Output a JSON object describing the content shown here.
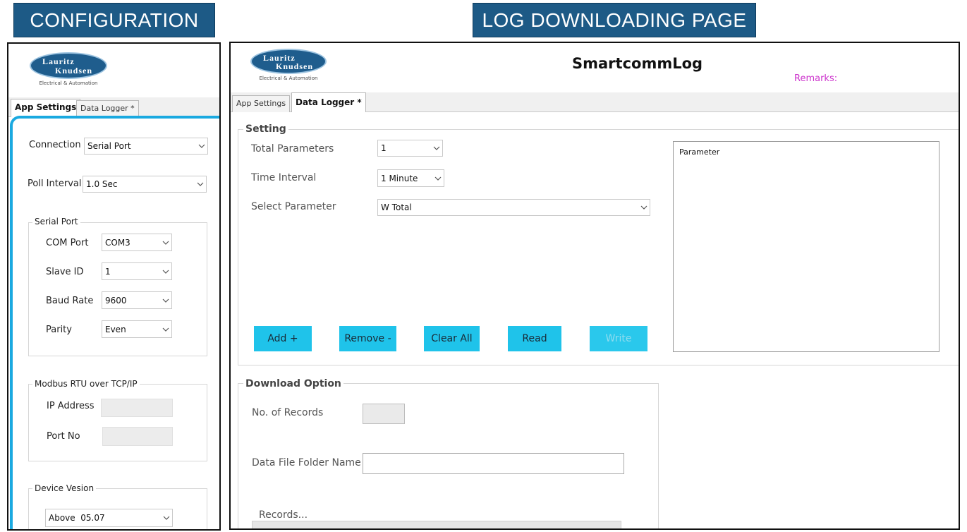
{
  "banners": {
    "left": "CONFIGURATION",
    "right": "LOG DOWNLOADING PAGE"
  },
  "logo": {
    "line1": "Lauritz",
    "line2": "Knudsen",
    "tagline": "Electrical & Automation"
  },
  "config": {
    "tabs": [
      {
        "label": "App Settings",
        "active": true
      },
      {
        "label": "Data Logger *",
        "active": false
      }
    ],
    "connection": {
      "label": "Connection",
      "value": "Serial Port"
    },
    "poll_interval": {
      "label": "Poll Interval",
      "value": "1.0 Sec"
    },
    "serial_port": {
      "title": "Serial Port",
      "com_port": {
        "label": "COM Port",
        "value": "COM3"
      },
      "slave_id": {
        "label": "Slave ID",
        "value": "1"
      },
      "baud_rate": {
        "label": "Baud Rate",
        "value": "9600"
      },
      "parity": {
        "label": "Parity",
        "value": "Even"
      }
    },
    "modbus": {
      "title": "Modbus RTU over TCP/IP",
      "ip_address": {
        "label": "IP Address",
        "value": ""
      },
      "port_no": {
        "label": "Port No",
        "value": ""
      }
    },
    "device_version": {
      "title": "Device Vesion",
      "value": "Above  05.07"
    }
  },
  "logpage": {
    "app_title": "SmartcommLog",
    "remarks_label": "Remarks:",
    "tabs": [
      {
        "label": "App Settings",
        "active": false
      },
      {
        "label": "Data Logger *",
        "active": true
      }
    ],
    "setting": {
      "title": "Setting",
      "total_parameters": {
        "label": "Total Parameters",
        "value": "1"
      },
      "time_interval": {
        "label": "Time Interval",
        "value": "1 Minute"
      },
      "select_parameter": {
        "label": "Select Parameter",
        "value": "W Total"
      },
      "parameter_list_header": "Parameter",
      "buttons": {
        "add": "Add +",
        "remove": "Remove -",
        "clear_all": "Clear All",
        "read": "Read",
        "write": "Write"
      }
    },
    "download": {
      "title": "Download Option",
      "no_of_records": {
        "label": "No. of Records",
        "value": ""
      },
      "folder_name": {
        "label": "Data File Folder Name",
        "value": ""
      },
      "records_label": "Records..."
    }
  },
  "colors": {
    "banner_bg": "#1d5a86",
    "button_bg": "#1fc3ea",
    "config_accent": "#1aa9e0",
    "remarks": "#cc33cc"
  }
}
